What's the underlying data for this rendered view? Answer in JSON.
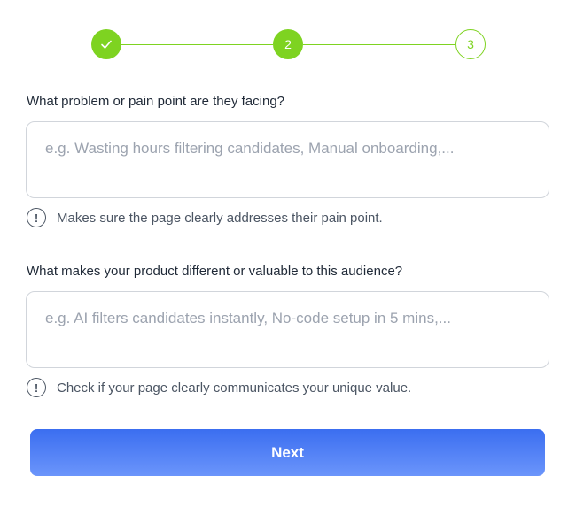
{
  "stepper": {
    "steps": [
      {
        "label": "",
        "state": "completed",
        "icon": "check-icon"
      },
      {
        "label": "2",
        "state": "active"
      },
      {
        "label": "3",
        "state": "pending"
      }
    ],
    "color": "#7ed321"
  },
  "questions": [
    {
      "label": "What problem or pain point are they facing?",
      "value": "",
      "placeholder": "e.g. Wasting hours filtering candidates, Manual onboarding,...",
      "hint": "Makes sure the page clearly addresses their pain point.",
      "hint_icon": "info-icon"
    },
    {
      "label": "What makes your product different or valuable to this audience?",
      "value": "",
      "placeholder": "e.g. AI filters candidates instantly, No-code setup in 5 mins,...",
      "hint": "Check if your page clearly communicates your unique value.",
      "hint_icon": "info-icon"
    }
  ],
  "next_button": {
    "label": "Next",
    "color_start": "#3b6ef0",
    "color_end": "#6b95fb"
  }
}
